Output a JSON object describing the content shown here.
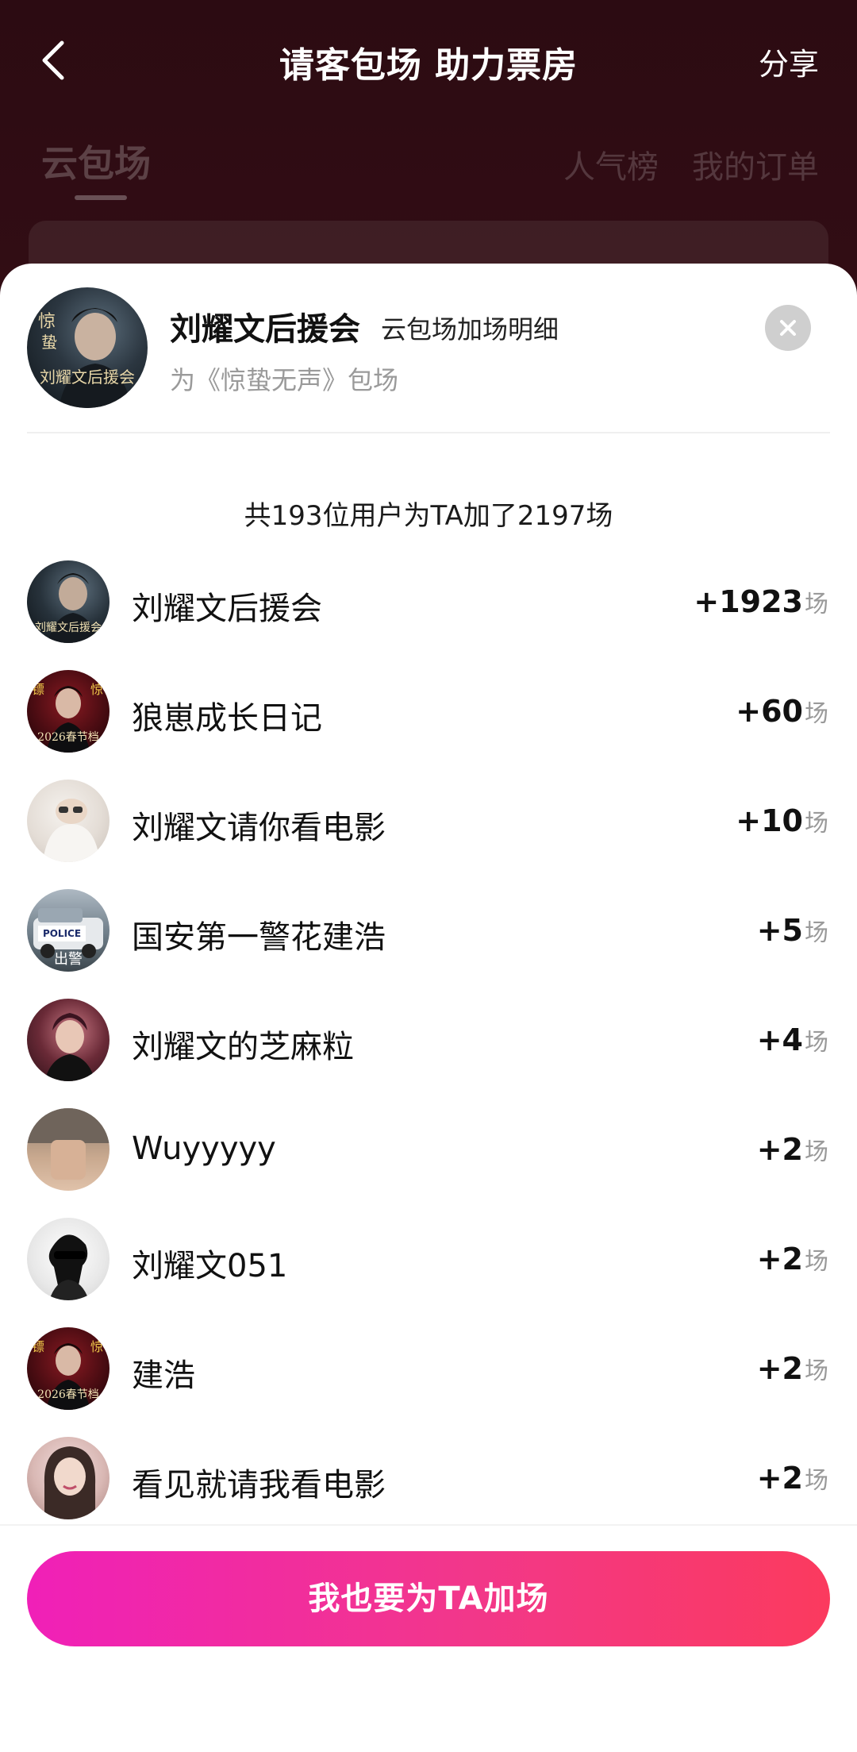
{
  "topbar": {
    "title": "请客包场 助力票房",
    "share_label": "分享"
  },
  "background_tabs": {
    "cloud": "云包场",
    "popular": "人气榜",
    "orders": "我的订单"
  },
  "sheet": {
    "title": "刘耀文后援会",
    "subtitle": "云包场加场明细",
    "movie_line": "为《惊蛰无声》包场",
    "header_avatar_text": "刘耀文后援会",
    "summary": "共193位用户为TA加了2197场",
    "unit": "场",
    "rows": [
      {
        "name": "刘耀文后援会",
        "count": "+1923",
        "avatar_text": "刘耀文后援会"
      },
      {
        "name": "狼崽成长日记",
        "count": "+60",
        "avatar_text": "2026春节档"
      },
      {
        "name": "刘耀文请你看电影",
        "count": "+10",
        "avatar_text": ""
      },
      {
        "name": "国安第一警花建浩",
        "count": "+5",
        "avatar_text": "出警"
      },
      {
        "name": "刘耀文的芝麻粒",
        "count": "+4",
        "avatar_text": ""
      },
      {
        "name": "Wuyyyyy",
        "count": "+2",
        "avatar_text": ""
      },
      {
        "name": "刘耀文051",
        "count": "+2",
        "avatar_text": ""
      },
      {
        "name": "建浩",
        "count": "+2",
        "avatar_text": "2026春节档"
      },
      {
        "name": "看见就请我看电影",
        "count": "+2",
        "avatar_text": ""
      }
    ],
    "police_label": "POLICE",
    "cta_label": "我也要为TA加场"
  }
}
